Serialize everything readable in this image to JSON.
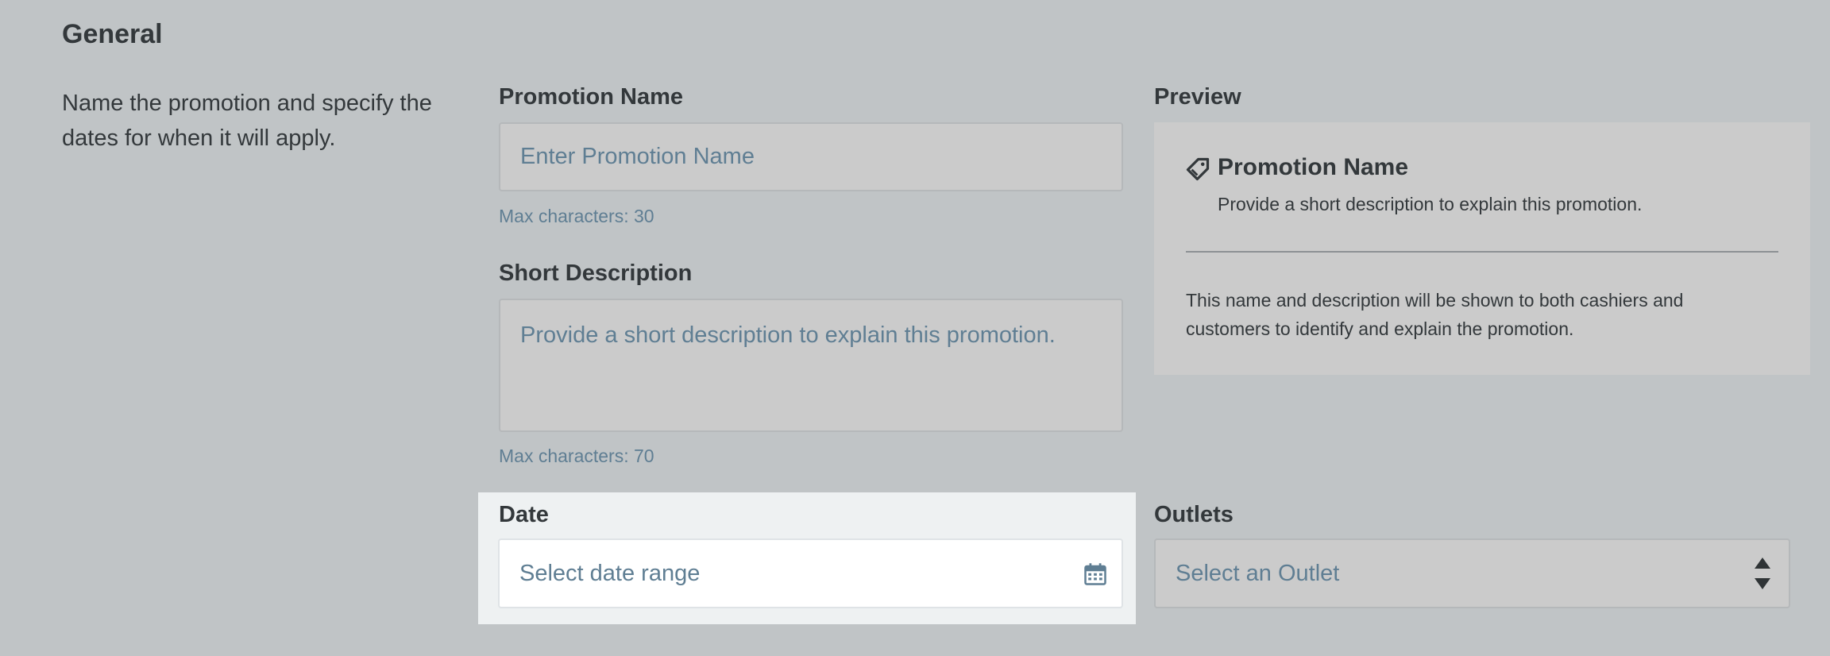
{
  "section": {
    "title": "General",
    "description": "Name the promotion and specify the dates for when it will apply."
  },
  "promotion_name": {
    "label": "Promotion Name",
    "placeholder": "Enter Promotion Name",
    "value": "",
    "hint": "Max characters: 30"
  },
  "short_description": {
    "label": "Short Description",
    "placeholder": "Provide a short description to explain this promotion.",
    "value": "",
    "hint": "Max characters: 70"
  },
  "preview": {
    "label": "Preview",
    "icon": "tag-icon",
    "name": "Promotion Name",
    "short": "Provide a short description to explain this promotion.",
    "note": "This name and description will be shown to both cashiers and customers to identify and explain the promotion."
  },
  "date": {
    "label": "Date",
    "placeholder": "Select date range",
    "icon": "calendar-icon"
  },
  "outlets": {
    "label": "Outlets",
    "placeholder": "Select an Outlet",
    "icon": "select-arrows-icon"
  },
  "colors": {
    "background": "#c0c4c6",
    "highlight_panel": "#eef1f2",
    "input_fill": "#cbcbcb",
    "placeholder_text": "#5f7e93",
    "label_text": "#33383b"
  }
}
